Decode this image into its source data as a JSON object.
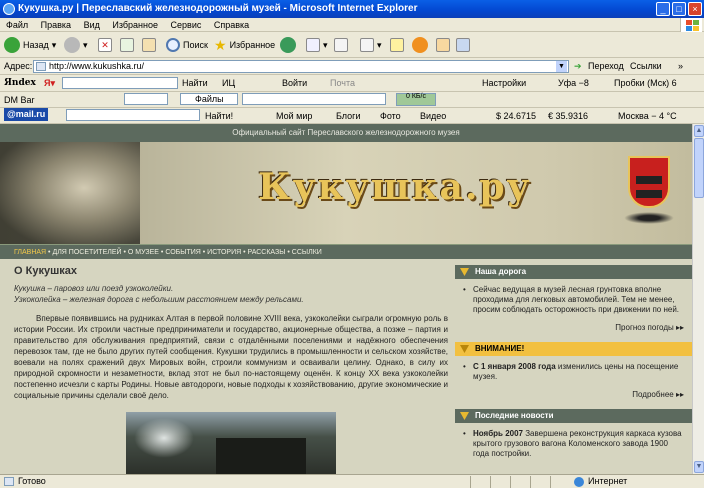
{
  "window": {
    "title": "Кукушка.ру | Переславский железнодорожный музей - Microsoft Internet Explorer"
  },
  "menu": [
    "Файл",
    "Правка",
    "Вид",
    "Избранное",
    "Сервис",
    "Справка"
  ],
  "toolbar": {
    "back": "Назад",
    "search": "Поиск",
    "favorites": "Избранное"
  },
  "address": {
    "label": "Адрес:",
    "url": "http://www.kukushka.ru/",
    "go": "Переход",
    "links": "Ссылки"
  },
  "yandex": {
    "logo": "Яndex",
    "find": "Найти",
    "ic": "ИЦ",
    "login": "Войти",
    "mail": "Почта",
    "settings": "Настройки",
    "weather": "Уфа −8",
    "traffic": "Пробки (Мск) 6"
  },
  "dmbar": {
    "label": "DM Bar",
    "files": "Файлы",
    "kb": "0 КБ/с"
  },
  "mailru": {
    "logo": "@mail.ru",
    "find": "Найти!",
    "myworld": "Мой мир",
    "blogs": "Блоги",
    "photo": "Фото",
    "video": "Видео",
    "usd": "$ 24.6715",
    "eur": "€ 35.9316",
    "city": "Москва − 4 °С"
  },
  "site": {
    "header": "Официальный сайт Переславского железнодорожного музея",
    "logo": "Кукушка.ру",
    "nav": [
      "ГЛАВНАЯ",
      "ДЛЯ ПОСЕТИТЕЛЕЙ",
      "О МУЗЕЕ",
      "СОБЫТИЯ",
      "ИСТОРИЯ",
      "РАССКАЗЫ",
      "ССЫЛКИ"
    ],
    "title": "О Кукушках",
    "lead1": "Кукушка – паровоз или поезд узкоколейки.",
    "lead2": "Узкоколейка – железная дорога с небольшим расстоянием между рельсами.",
    "body": "Впервые появившись на рудниках Алтая в первой половине XVIII века, узкоколейки сыграли огромную роль в истории России. Их строили частные предприниматели и государство, акционерные общества, а позже – партия и правительство для обслуживания предприятий, связи с отдалёнными поселениями и надёжного обеспечения перевозок там, где не было других путей сообщения. Кукушки трудились в промышленности и сельском хозяйстве, воевали на полях сражений двух Мировых войн, строили коммунизм и осваивали целину. Однако, в силу их природной скромности и незаметности, вклад этот не был по-настоящему оценён. К концу XX века узкоколейки постепенно исчезли с карты Родины. Новые автодороги, новые подходы к хозяйствованию, другие экономические и социальные причины сделали своё дело.",
    "box1": {
      "title": "Наша дорога",
      "text": "Сейчас ведущая в музей лесная грунтовка вполне проходима для легковых автомобилей. Тем не менее, просим соблюдать осторожность при движении по ней.",
      "more": "Прогноз погоды ▸▸"
    },
    "box2": {
      "title": "ВНИМАНИЕ!",
      "date": "С 1 января 2008 года",
      "text": " изменились цены на посещение музея.",
      "more": "Подробнее ▸▸"
    },
    "box3": {
      "title": "Последние новости",
      "date": "Ноябрь 2007",
      "text": " Завершена реконструкция каркаса кузова крытого грузового вагона Коломенского завода 1900 года постройки."
    }
  },
  "status": {
    "left": "Готово",
    "zone": "Интернет"
  }
}
